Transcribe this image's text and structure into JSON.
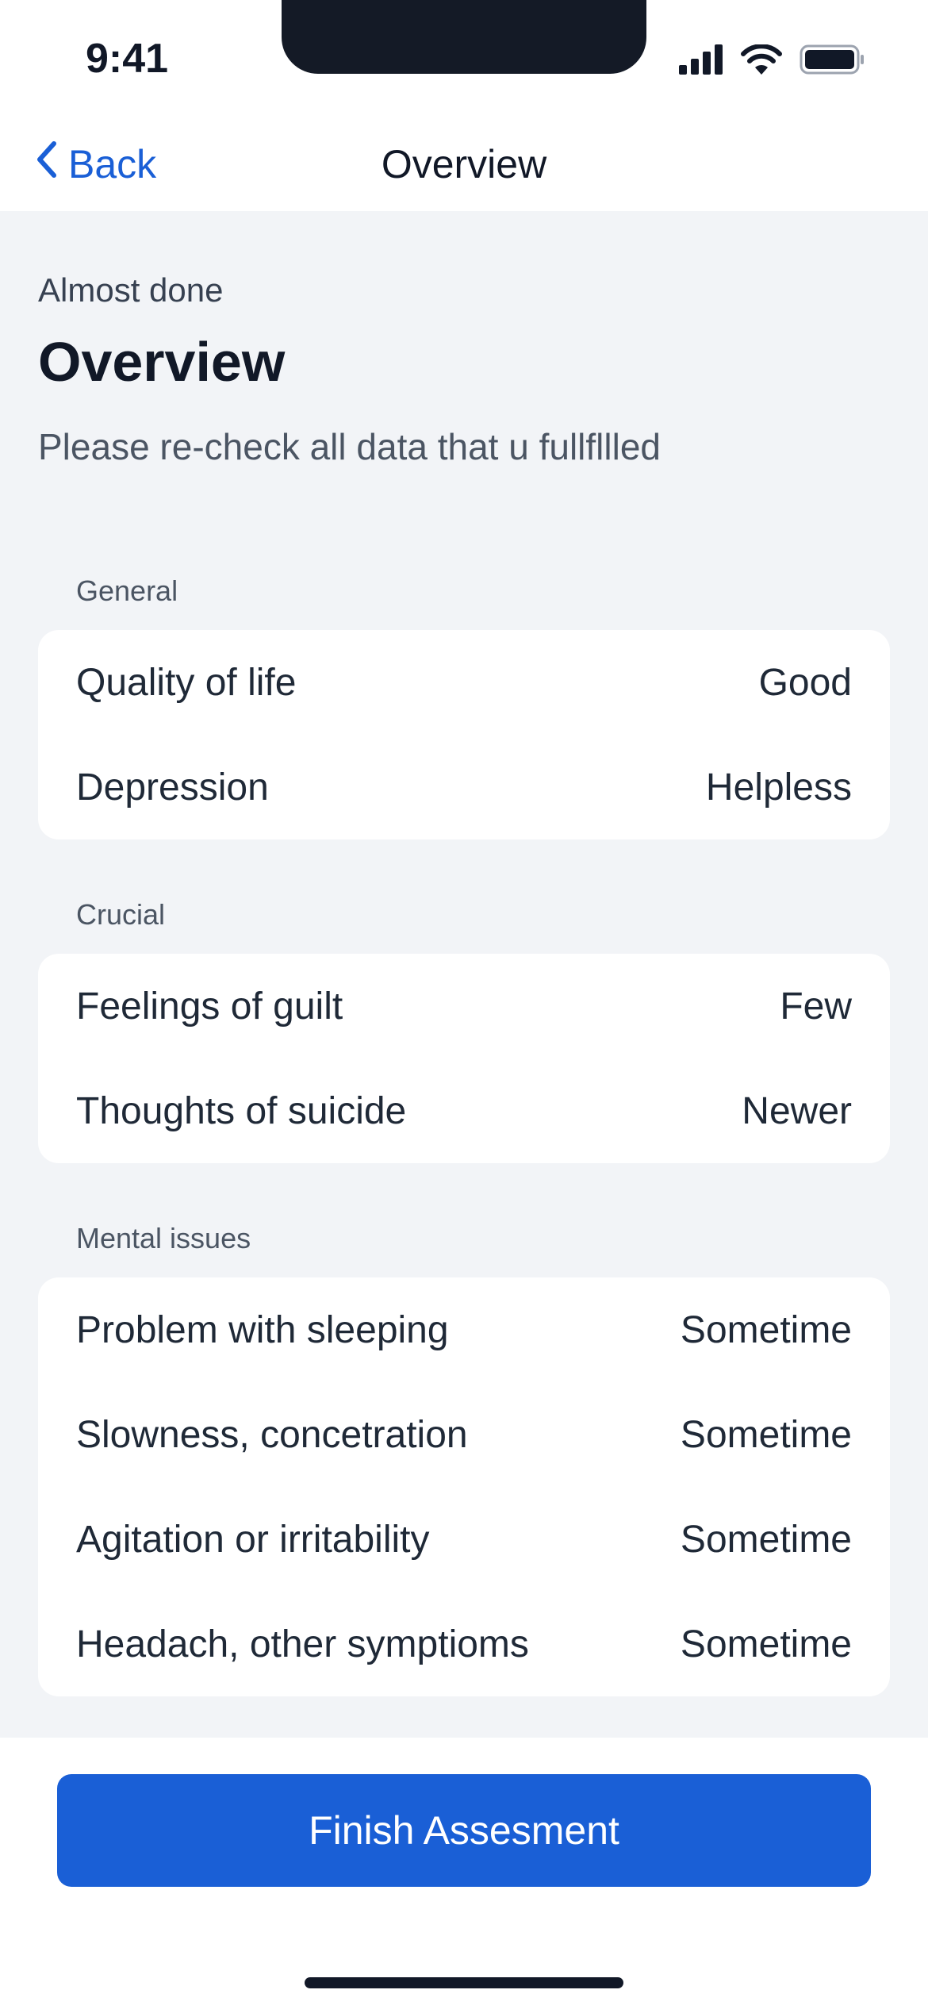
{
  "status_bar": {
    "time": "9:41",
    "icons": [
      "signal-icon",
      "wifi-icon",
      "battery-icon"
    ]
  },
  "nav": {
    "back_label": "Back",
    "title": "Overview",
    "back_icon": "chevron-left-icon"
  },
  "header": {
    "eyebrow": "Almost done",
    "title": "Overview",
    "subtitle": "Please re-check all data that u fullfllled"
  },
  "sections": [
    {
      "label": "General",
      "rows": [
        {
          "label": "Quality of life",
          "value": "Good"
        },
        {
          "label": "Depression",
          "value": "Helpless"
        }
      ]
    },
    {
      "label": "Crucial",
      "rows": [
        {
          "label": "Feelings of guilt",
          "value": "Few"
        },
        {
          "label": "Thoughts of suicide",
          "value": "Newer"
        }
      ]
    },
    {
      "label": "Mental issues",
      "rows": [
        {
          "label": "Problem with sleeping",
          "value": "Sometime"
        },
        {
          "label": "Slowness, concetration",
          "value": "Sometime"
        },
        {
          "label": "Agitation or irritability",
          "value": "Sometime"
        },
        {
          "label": "Headach, other symptioms",
          "value": "Sometime"
        }
      ]
    }
  ],
  "footer": {
    "finish_label": "Finish Assesment"
  },
  "colors": {
    "accent": "#1a5fd6",
    "background": "#f2f4f7",
    "card": "#ffffff",
    "text": "#111827"
  }
}
